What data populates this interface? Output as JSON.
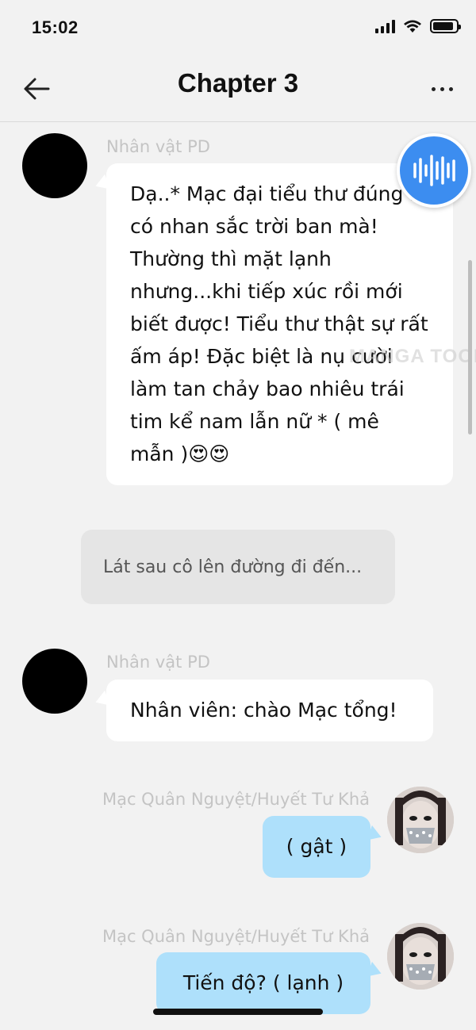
{
  "status_bar": {
    "time": "15:02",
    "battery_level": 0.9
  },
  "header": {
    "title": "Chapter 3",
    "back_icon": "back-arrow-icon",
    "more_icon": "more-horizontal-icon"
  },
  "messages": [
    {
      "type": "left",
      "sender": "Nhân vật PD",
      "text": "Dạ..* Mạc đại tiểu thư đúng là có nhan sắc trời ban mà! Thường thì mặt lạnh nhưng...khi tiếp xúc rồi mới biết được! Tiểu thư thật sự rất ấm áp! Đặc biệt là nụ cười làm tan chảy bao nhiêu trái tim kể nam lẫn nữ * ( mê mẫn )😍😍"
    },
    {
      "type": "narration",
      "text": "Lát sau cô lên đường đi đến..."
    },
    {
      "type": "left",
      "sender": "Nhân vật PD",
      "text": "Nhân viên: chào Mạc tổng!"
    },
    {
      "type": "right",
      "sender": "Mạc Quân Nguyệt/Huyết Tư Khả",
      "text": "( gật )"
    },
    {
      "type": "right",
      "sender": "Mạc Quân Nguyệt/Huyết Tư Khả",
      "text": "Tiến độ? ( lạnh )"
    }
  ],
  "watermark": "MANGA TOON",
  "voice_button_icon": "voice-waveform-icon",
  "colors": {
    "right_bubble": "#aee0fb",
    "voice_button": "#3c8df0",
    "background": "#f2f2f2"
  }
}
